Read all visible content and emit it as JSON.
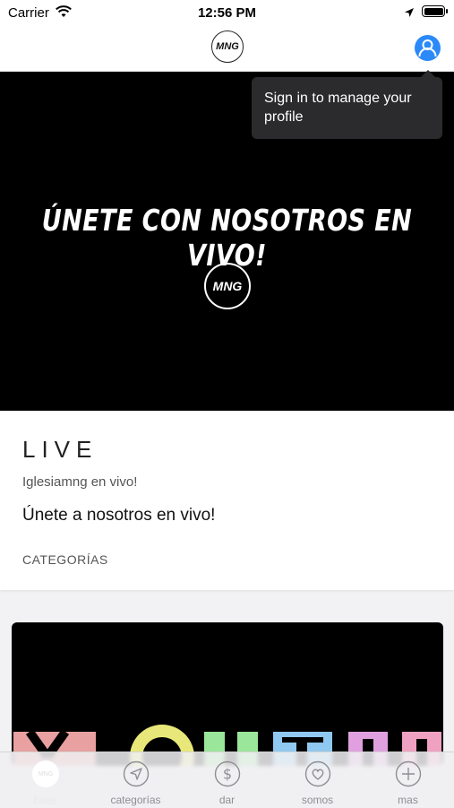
{
  "status_bar": {
    "carrier": "Carrier",
    "time": "12:56 PM"
  },
  "nav": {
    "logo_text": "MNG"
  },
  "tooltip": {
    "text": "Sign in to manage your profile"
  },
  "hero": {
    "title": "ÚNETE CON NOSOTROS EN VIVO!",
    "logo_text": "MNG"
  },
  "info": {
    "title": "LIVE",
    "subtitle": "Iglesiamng en vivo!",
    "description": "Únete a nosotros en vivo!",
    "categories_label": "CATEGORÍAS"
  },
  "card2": {
    "letter_colors": [
      "#e8a0a0",
      "#e8e87a",
      "#9ae69a",
      "#8fc8f0",
      "#e0a0e0",
      "#f0a0c0"
    ]
  },
  "tabs": [
    {
      "label": "base",
      "icon": "home-logo-icon",
      "active": true
    },
    {
      "label": "categorías",
      "icon": "navigation-arrow-icon"
    },
    {
      "label": "dar",
      "icon": "dollar-icon"
    },
    {
      "label": "somos",
      "icon": "heart-icon"
    },
    {
      "label": "mas",
      "icon": "plus-icon"
    }
  ],
  "colors": {
    "accent": "#2b8af7",
    "tooltip_bg": "#2b2b2d",
    "tab_inactive": "#8e8e93"
  }
}
